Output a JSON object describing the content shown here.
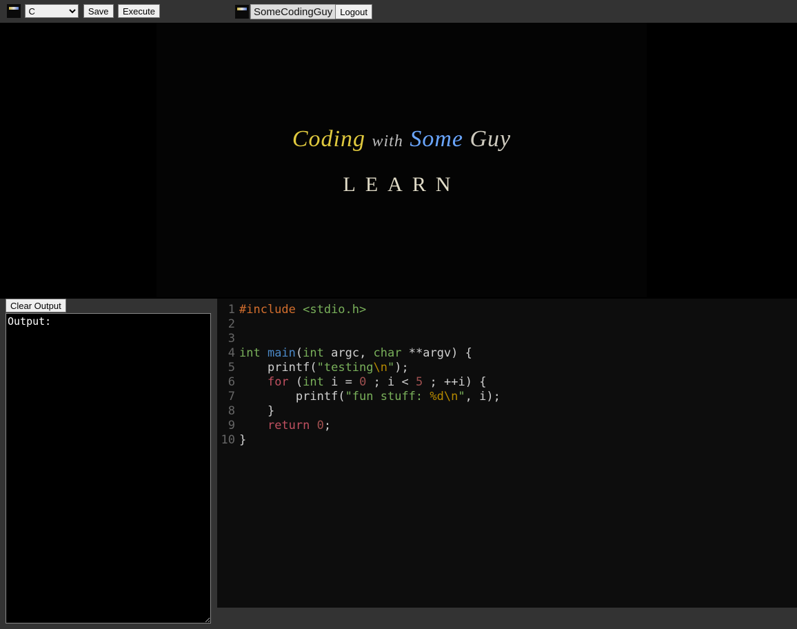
{
  "toolbar": {
    "language_selected": "C",
    "save_label": "Save",
    "execute_label": "Execute"
  },
  "user": {
    "name": "SomeCodingGuy",
    "logout_label": "Logout"
  },
  "banner": {
    "word_coding": "Coding",
    "word_with": "with",
    "word_some": "Some",
    "word_guy": "Guy",
    "subtitle": "LEARN"
  },
  "output": {
    "clear_label": "Clear Output",
    "text": "Output:"
  },
  "code": {
    "lines": [
      {
        "n": "1",
        "pp": "#include ",
        "inc": "<stdio.h>"
      },
      {
        "n": "2",
        "plain": ""
      },
      {
        "n": "3",
        "plain": ""
      },
      {
        "n": "4",
        "t1": "int ",
        "fn": "main",
        "t2": "(",
        "t3": "int ",
        "id1": "argc",
        "t4": ", ",
        "t5": "char ",
        "t6": "**",
        "id2": "argv",
        "t7": ") {"
      },
      {
        "n": "5",
        "indent": "    ",
        "call": "printf",
        "p1": "(",
        "s1": "\"testing",
        "esc1": "\\n",
        "s1b": "\"",
        "p2": ");"
      },
      {
        "n": "6",
        "indent": "    ",
        "kw": "for ",
        "p1": "(",
        "ty": "int ",
        "id": "i",
        "eq": " = ",
        "n0": "0",
        "sep1": " ; ",
        "id2": "i",
        "lt": " < ",
        "n5": "5",
        "sep2": " ; ",
        "pp2": "++",
        "id3": "i",
        "p2": ") {"
      },
      {
        "n": "7",
        "indent": "        ",
        "call": "printf",
        "p1": "(",
        "s1": "\"fun stuff: ",
        "fmt": "%d",
        "esc": "\\n",
        "s1b": "\"",
        "comma": ", ",
        "id": "i",
        "p2": ");"
      },
      {
        "n": "8",
        "indent": "    ",
        "plain": "}"
      },
      {
        "n": "9",
        "indent": "    ",
        "kw": "return ",
        "n0": "0",
        "semi": ";"
      },
      {
        "n": "10",
        "plain": "}"
      }
    ]
  }
}
